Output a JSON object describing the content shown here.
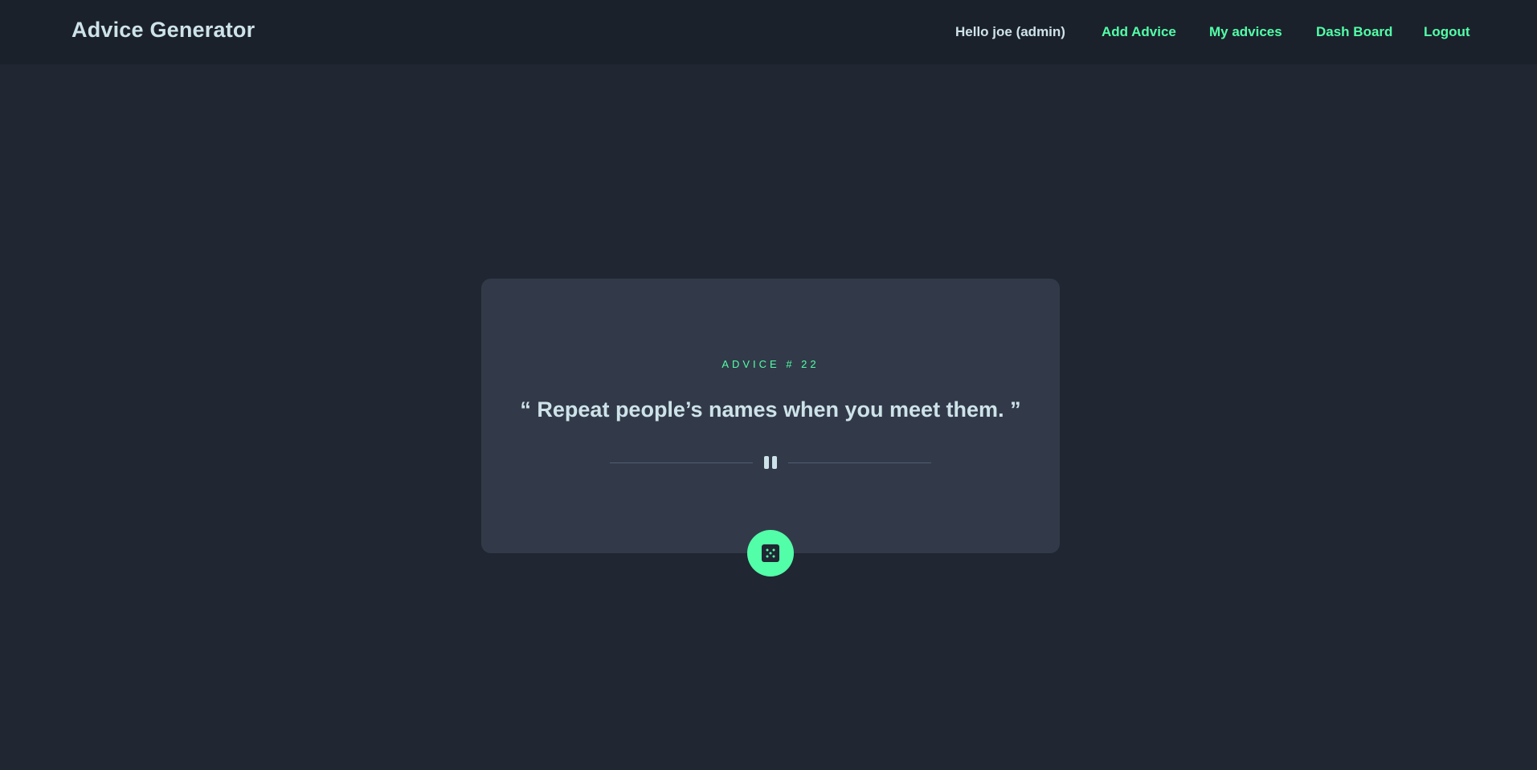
{
  "navbar": {
    "brand": "Advice Generator",
    "greeting": "Hello joe (admin)",
    "links": {
      "add_advice": "Add Advice",
      "my_advices": "My advices",
      "dashboard": "Dash Board",
      "logout": "Logout"
    }
  },
  "card": {
    "advice_id": "ADVICE # 22",
    "advice_text": "“ Repeat people’s names when you meet them. ”",
    "divider_icon": "pause-icon",
    "button_icon": "dice-icon"
  },
  "colors": {
    "background": "#202632",
    "navbar": "#1b212b",
    "card": "#323a49",
    "accent": "#52ffa8",
    "text": "#cee3e9"
  }
}
